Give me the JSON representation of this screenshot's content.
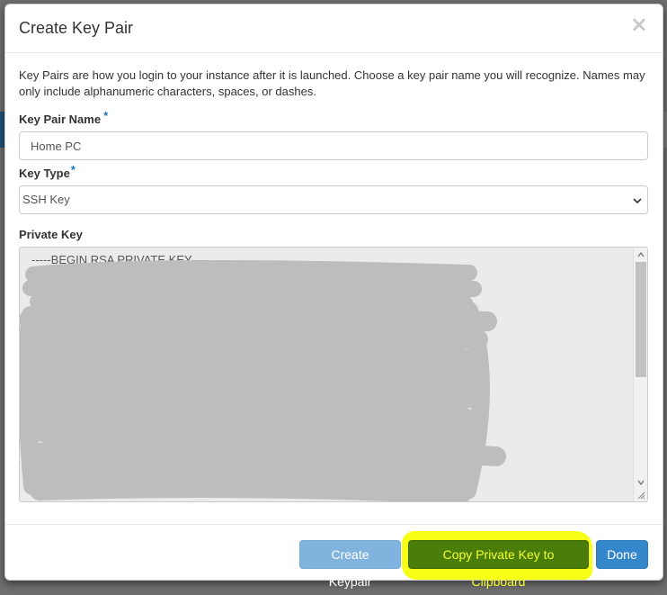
{
  "dialog": {
    "title": "Create Key Pair",
    "close_glyph": "×",
    "help_text": "Key Pairs are how you login to your instance after it is launched. Choose a key pair name you will recognize. Names may only include alphanumeric characters, spaces, or dashes.",
    "key_pair_name": {
      "label": "Key Pair Name",
      "required_mark": "*",
      "value": "Home PC"
    },
    "key_type": {
      "label": "Key Type",
      "required_mark": "*",
      "selected": "SSH Key"
    },
    "private_key": {
      "label": "Private Key",
      "first_line": "-----BEGIN RSA PRIVATE KEY-----"
    }
  },
  "footer": {
    "create_label": "Create Keypair",
    "copy_label": "Copy Private Key to Clipboard",
    "done_label": "Done"
  },
  "colors": {
    "required_asterisk": "#1c74bb",
    "primary_button": "#3587cc",
    "disabled_primary": "#81b3df",
    "highlight": "#f7ff16",
    "copy_button": "#4a7d0a"
  },
  "icons": {
    "close": "close-icon",
    "select_arrow": "chevron-down-icon"
  }
}
